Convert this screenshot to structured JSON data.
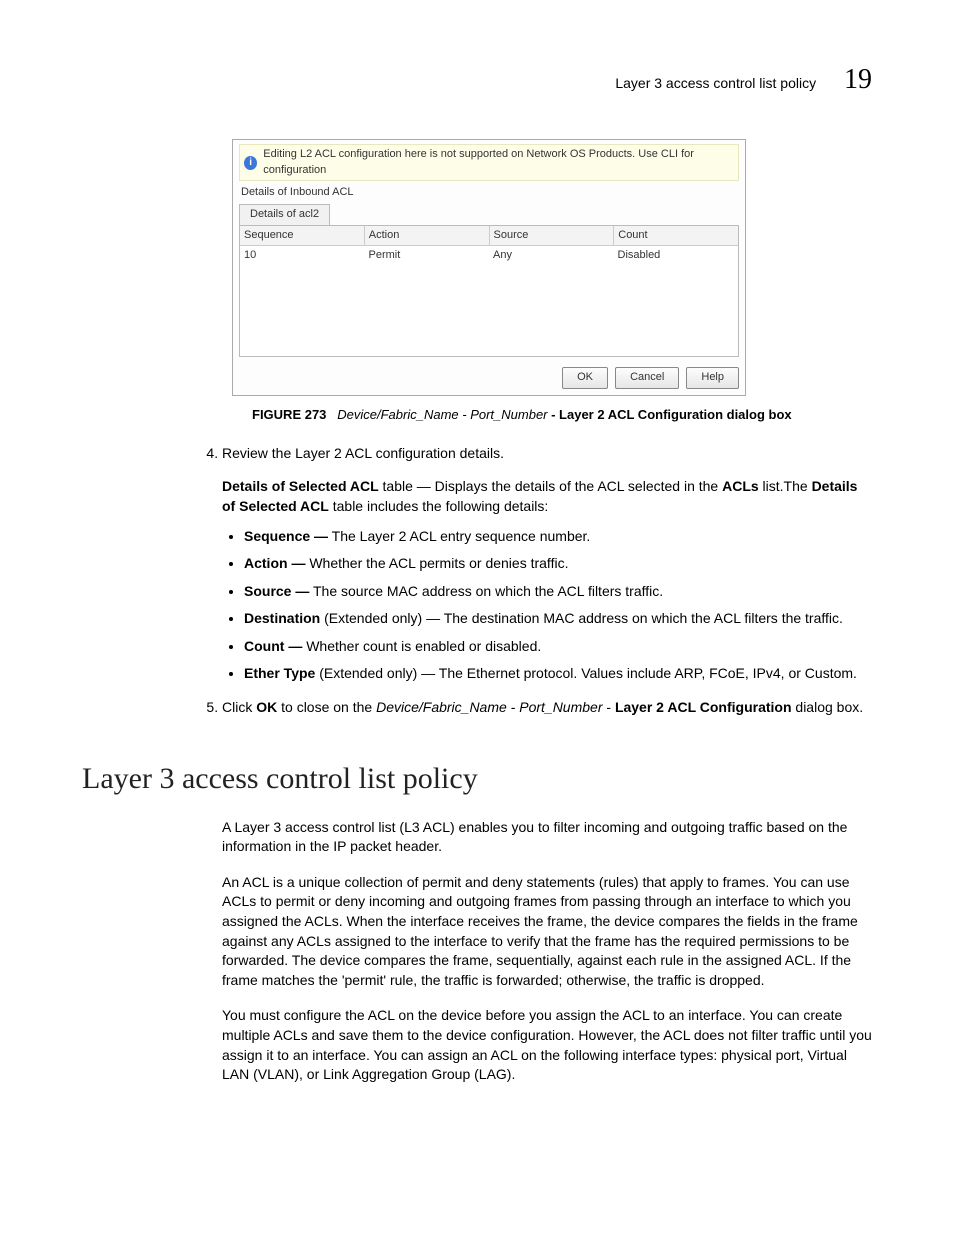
{
  "runhead": {
    "title": "Layer 3 access control list policy",
    "number": "19"
  },
  "dialog": {
    "infotext": "Editing L2 ACL configuration here is not supported on Network OS Products. Use CLI for configuration",
    "details_label": "Details of Inbound ACL",
    "tab_label": "Details of acl2",
    "columns": [
      "Sequence",
      "Action",
      "Source",
      "Count"
    ],
    "row": [
      "10",
      "Permit",
      "Any",
      "Disabled"
    ],
    "buttons": {
      "ok": "OK",
      "cancel": "Cancel",
      "help": "Help"
    }
  },
  "figure": {
    "label": "FIGURE 273",
    "italic": "Device/Fabric_Name - Port_Number",
    "tail": " - Layer 2 ACL Configuration dialog box"
  },
  "step4": {
    "num": "4.",
    "lead": "Review the Layer 2 ACL configuration details.",
    "p1a": "Details of Selected ACL",
    "p1b": " table — Displays the details of the ACL selected in the ",
    "p1c": "ACLs",
    "p1d": " list.The ",
    "p1e": "Details of Selected ACL",
    "p1f": " table includes the following details:",
    "bullets": [
      {
        "b": "Sequence —",
        "t": " The Layer 2 ACL entry sequence number."
      },
      {
        "b": "Action —",
        "t": " Whether the ACL permits or denies traffic."
      },
      {
        "b": "Source —",
        "t": " The source MAC address on which the ACL filters traffic."
      },
      {
        "b": "Destination",
        "t": " (Extended only) — The destination MAC address on which the ACL filters the traffic."
      },
      {
        "b": "Count —",
        "t": " Whether count is enabled or disabled."
      },
      {
        "b": "Ether Type",
        "t": " (Extended only) — The Ethernet protocol. Values include ARP, FCoE, IPv4, or Custom."
      }
    ]
  },
  "step5": {
    "num": "5.",
    "a": "Click ",
    "b": "OK",
    "c": " to close on the ",
    "d": "Device/Fabric_Name - Port_Number",
    "e": " - ",
    "f": "Layer 2 ACL Configuration",
    "g": " dialog box."
  },
  "heading": "Layer 3 access control list policy",
  "para1": "A Layer 3 access control list (L3 ACL) enables you to filter incoming and outgoing traffic based on the information in the IP packet header.",
  "para2": "An ACL is a unique collection of permit and deny statements (rules) that apply to frames. You can use ACLs to permit or deny incoming and outgoing frames from passing through an interface to which you assigned the ACLs. When the interface receives the frame, the device compares the fields in the frame against any ACLs assigned to the interface to verify that the frame has the required permissions to be forwarded. The device compares the frame, sequentially, against each rule in the assigned ACL. If the frame matches the 'permit' rule, the traffic is forwarded; otherwise, the traffic is dropped.",
  "para3": "You must configure the ACL on the device before you assign the ACL to an interface. You can create multiple ACLs and save them to the device configuration. However, the ACL does not filter traffic until you assign it to an interface. You can assign an ACL on the following interface types: physical port, Virtual LAN (VLAN), or Link Aggregation Group (LAG)."
}
